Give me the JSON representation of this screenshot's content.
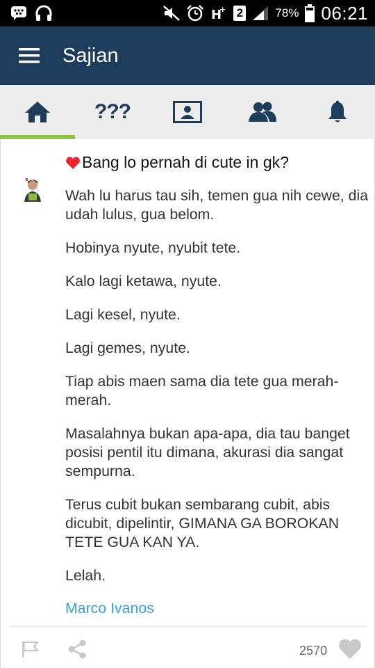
{
  "status_bar": {
    "battery_percent": "78%",
    "sim_slot": "2",
    "time": "06:21",
    "icons": [
      "bbm-icon",
      "headphones-icon",
      "mute-icon",
      "alarm-icon",
      "hplus-icon",
      "signal-icon",
      "battery-icon"
    ]
  },
  "app_bar": {
    "title": "Sajian"
  },
  "tabs": [
    {
      "name": "home",
      "icon": "home-icon",
      "active": true
    },
    {
      "name": "questions",
      "label": "???",
      "active": false
    },
    {
      "name": "profile",
      "icon": "profile-card-icon",
      "active": false
    },
    {
      "name": "friends",
      "icon": "friends-icon",
      "active": false
    },
    {
      "name": "notifications",
      "icon": "bell-icon",
      "active": false
    }
  ],
  "post": {
    "title": "Bang lo pernah di cute in gk?",
    "paragraphs": [
      "Wah lu harus tau sih, temen gua nih cewe, dia udah lulus, gua belom.",
      "Hobinya nyute, nyubit tete.",
      "Kalo lagi ketawa, nyute.",
      "Lagi kesel, nyute.",
      "Lagi gemes, nyute.",
      "Tiap abis maen sama dia tete gua merah-merah.",
      "Masalahnya bukan apa-apa, dia tau banget posisi pentil itu dimana, akurasi dia sangat sempurna.",
      "Terus cubit bukan sembarang cubit, abis dicubit, dipelintir, GIMANA GA BOROKAN TETE GUA KAN YA.",
      "Lelah."
    ],
    "author": "Marco Ivanos",
    "like_count": "2570"
  },
  "colors": {
    "app_bar": "#1e3d5a",
    "tab_active_indicator": "#8cc63f",
    "author_link": "#3aa0d6",
    "heart_red": "#e8262f"
  }
}
